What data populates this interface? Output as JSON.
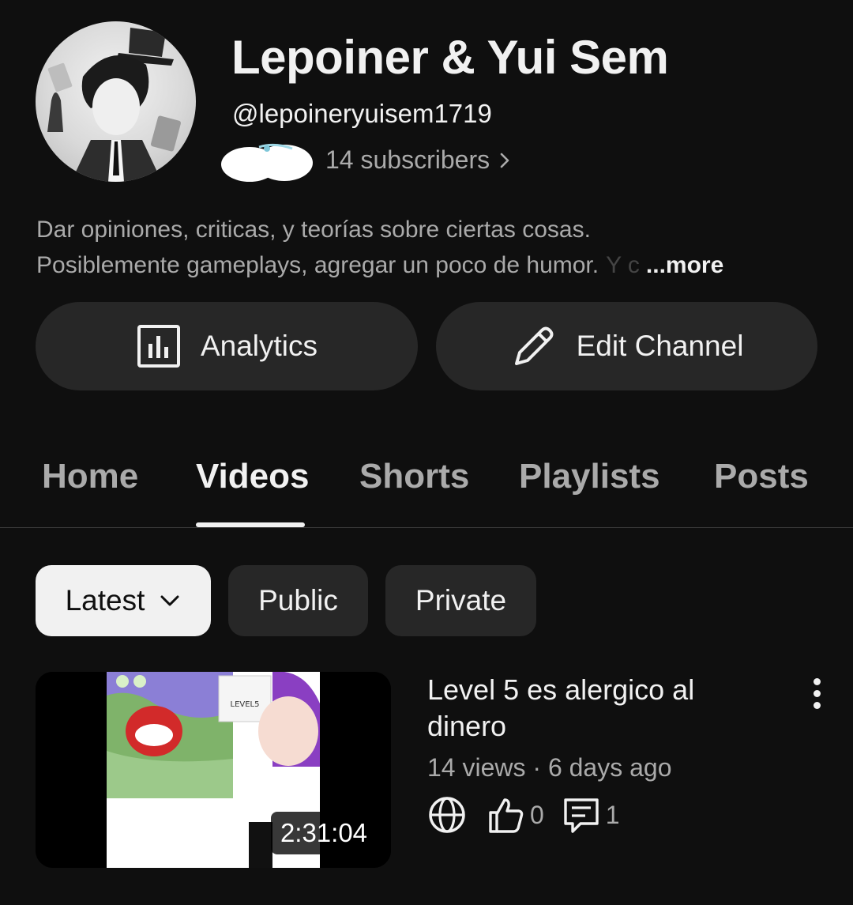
{
  "channel": {
    "name": "Lepoiner & Yui Sem",
    "handle": "@lepoineryuisem1719",
    "subscribers": "14 subscribers",
    "description_line1": "Dar opiniones, criticas, y teorías sobre ciertas cosas.",
    "description_line2": "Posiblemente gameplays, agregar un poco de humor.",
    "description_fade": "Y c",
    "more_label": "...more"
  },
  "actions": {
    "analytics_label": "Analytics",
    "edit_label": "Edit Channel"
  },
  "tabs": [
    {
      "label": "Home",
      "active": false
    },
    {
      "label": "Videos",
      "active": true
    },
    {
      "label": "Shorts",
      "active": false
    },
    {
      "label": "Playlists",
      "active": false
    },
    {
      "label": "Posts",
      "active": false
    }
  ],
  "filters": [
    {
      "label": "Latest",
      "selected": true
    },
    {
      "label": "Public",
      "selected": false
    },
    {
      "label": "Private",
      "selected": false
    }
  ],
  "videos": [
    {
      "title": "Level 5 es alergico al dinero",
      "duration": "2:31:04",
      "meta": "14 views · 6 days ago",
      "likes": "0",
      "comments": "1",
      "thumbnail_text": "LEVEL5"
    }
  ],
  "icons": {
    "analytics": "bar-chart-icon",
    "edit": "pencil-icon",
    "chevron": "chevron-right-icon",
    "visibility": "globe-icon",
    "like": "thumbs-up-icon",
    "comments": "comment-icon",
    "menu": "kebab-menu-icon"
  }
}
